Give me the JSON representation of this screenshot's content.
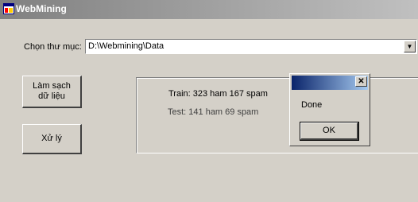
{
  "window": {
    "title": "WebMining",
    "icon": "app-window-icon"
  },
  "folder": {
    "label": "Chọn thư mục:",
    "value": "D:\\Webmining\\Data"
  },
  "buttons": {
    "clean_label": "Làm sạch\ndữ liệu",
    "process_label": "Xử lý"
  },
  "results": {
    "train": "Train: 323 ham 167 spam",
    "test": "Test: 141 ham 69 spam"
  },
  "dialog": {
    "message": "Done",
    "ok_label": "OK",
    "close_glyph": "✕"
  },
  "colors": {
    "titlebar_inactive": "#808080",
    "dialog_titlebar": "#0a246a",
    "face": "#d4d0c8"
  }
}
